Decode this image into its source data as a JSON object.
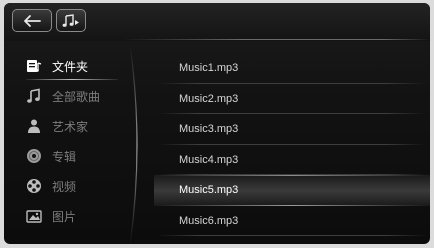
{
  "toolbar": {
    "back_icon": "arrow-left-icon",
    "music_icon": "music-note-play-icon"
  },
  "sidebar": {
    "active_index": 0,
    "items": [
      {
        "label": "文件夹",
        "icon": "folder-music-icon"
      },
      {
        "label": "全部歌曲",
        "icon": "music-note-icon"
      },
      {
        "label": "艺术家",
        "icon": "person-icon"
      },
      {
        "label": "专辑",
        "icon": "disc-icon"
      },
      {
        "label": "视频",
        "icon": "film-reel-icon"
      },
      {
        "label": "图片",
        "icon": "picture-icon"
      }
    ]
  },
  "files": {
    "selected_index": 4,
    "items": [
      {
        "name": "Music1.mp3"
      },
      {
        "name": "Music2.mp3"
      },
      {
        "name": "Music3.mp3"
      },
      {
        "name": "Music4.mp3"
      },
      {
        "name": "Music5.mp3"
      },
      {
        "name": "Music6.mp3"
      }
    ]
  },
  "colors": {
    "background": "#121212",
    "text_active": "#ffffff",
    "text_inactive": "#7d7d7d",
    "list_text": "#d6d6d6"
  }
}
